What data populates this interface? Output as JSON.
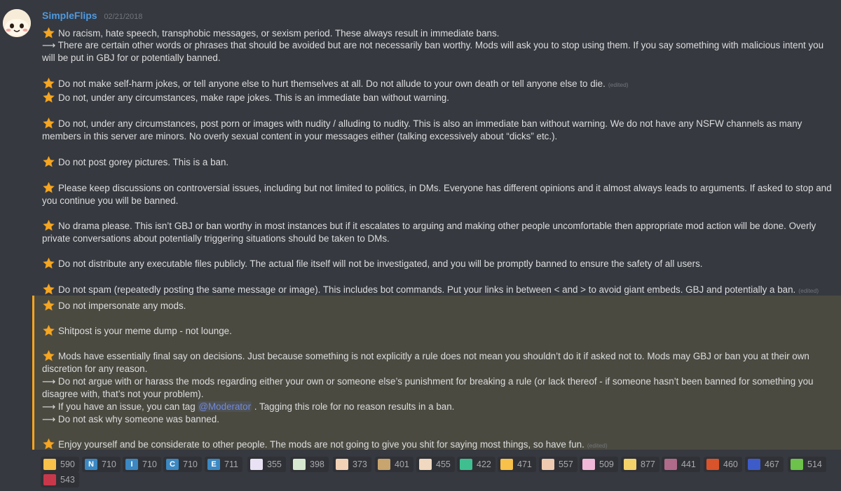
{
  "author": {
    "name": "SimpleFlips",
    "date": "02/21/2018"
  },
  "edited_label": "(edited)",
  "rules": [
    {
      "text": "No racism, hate speech, transphobic messages, or sexism period. These always result in immediate bans."
    },
    {
      "text": "⟶ There are certain other words or phrases that should be avoided but are not necessarily ban worthy. Mods will ask you to stop using them. If you say something with malicious intent you will be put in GBJ for or potentially banned."
    },
    {
      "text": "Do not make self-harm jokes, or tell anyone else to hurt themselves at all. Do not allude to your own death or tell anyone else to die."
    },
    {
      "text": "Do not, under any circumstances, make rape jokes. This is an immediate ban without warning."
    },
    {
      "text": "Do not, under any circumstances, post porn or images with nudity / alluding to nudity. This is also an immediate ban without warning. We do not have any NSFW channels as many members in this server are minors. No overly sexual content in your messages either (talking excessively about “dicks” etc.)."
    },
    {
      "text": "Do not post gorey pictures. This is a ban."
    },
    {
      "text": "Please keep discussions on controversial issues, including but not limited to politics, in DMs. Everyone has different opinions and it almost always leads to arguments. If asked to stop and you continue you will be banned."
    },
    {
      "text": "No drama please. This isn’t GBJ or ban worthy in most instances but if it escalates to arguing and making other people uncomfortable then appropriate mod action will be done. Overly private conversations about potentially triggering situations should be taken to DMs."
    },
    {
      "text": "Do not distribute any executable files publicly. The actual file itself will not be investigated, and you will be promptly banned to ensure the safety of all users."
    },
    {
      "text": "Do not spam (repeatedly posting the same message or image). This includes bot commands. Put your links in between < and > to avoid giant embeds. GBJ and potentially a ban."
    }
  ],
  "highlighted": [
    {
      "text": "Do not impersonate any mods."
    },
    {
      "text": "Shitpost is your meme dump - not lounge."
    },
    {
      "text": "Mods have essentially final say on decisions. Just because something is not explicitly a rule does not mean you shouldn’t do it if asked not to.  Mods may GBJ or ban you at their own discretion for any reason."
    },
    {
      "text": "⟶ Do not argue with or harass the mods regarding either your own or someone else’s punishment for breaking a rule (or lack thereof - if someone hasn’t been banned for something you disagree with, that’s not your problem)."
    },
    {
      "text_before": "⟶ If you have an issue, you can tag",
      "mention": "@Moderator",
      "text_after": ". Tagging this role for no reason results in a ban."
    },
    {
      "text": "⟶ Do not ask why someone was banned."
    },
    {
      "text": "Enjoy yourself and be considerate to other people. The mods are not going to give you shit for saying most things, so have fun."
    }
  ],
  "reactions": [
    {
      "icon": "thumbs-up-icon",
      "label": "",
      "count": "590",
      "color": "#f7c14a"
    },
    {
      "icon": "letter-n-icon",
      "label": "N",
      "count": "710",
      "color": "#3b88c3"
    },
    {
      "icon": "letter-i-icon",
      "label": "I",
      "count": "710",
      "color": "#3b88c3"
    },
    {
      "icon": "letter-c-icon",
      "label": "C",
      "count": "710",
      "color": "#3b88c3"
    },
    {
      "icon": "letter-e-icon",
      "label": "E",
      "count": "711",
      "color": "#3b88c3"
    },
    {
      "icon": "custom-emoji-icon",
      "label": "",
      "count": "355",
      "color": "#e9e2f5"
    },
    {
      "icon": "custom-emoji-icon",
      "label": "",
      "count": "398",
      "color": "#d7e8d0"
    },
    {
      "icon": "custom-emoji-icon",
      "label": "",
      "count": "373",
      "color": "#f2d3b6"
    },
    {
      "icon": "custom-emoji-icon",
      "label": "",
      "count": "401",
      "color": "#c8a46e"
    },
    {
      "icon": "custom-emoji-icon",
      "label": "",
      "count": "455",
      "color": "#f0d9c0"
    },
    {
      "icon": "custom-emoji-icon",
      "label": "",
      "count": "422",
      "color": "#3fbf8f"
    },
    {
      "icon": "heart-eyes-icon",
      "label": "",
      "count": "471",
      "color": "#f7c14a"
    },
    {
      "icon": "custom-emoji-icon",
      "label": "",
      "count": "557",
      "color": "#eecbb0"
    },
    {
      "icon": "custom-emoji-icon",
      "label": "",
      "count": "509",
      "color": "#f2b8d8"
    },
    {
      "icon": "custom-emoji-icon",
      "label": "",
      "count": "877",
      "color": "#f5d36b"
    },
    {
      "icon": "custom-emoji-icon",
      "label": "",
      "count": "441",
      "color": "#b06a8a"
    },
    {
      "icon": "custom-emoji-icon",
      "label": "",
      "count": "460",
      "color": "#d9532b"
    },
    {
      "icon": "custom-emoji-icon",
      "label": "",
      "count": "467",
      "color": "#3d5cc9"
    },
    {
      "icon": "custom-emoji-icon",
      "label": "",
      "count": "514",
      "color": "#6cc24a"
    },
    {
      "icon": "custom-emoji-icon",
      "label": "",
      "count": "543",
      "color": "#c9384a"
    }
  ]
}
